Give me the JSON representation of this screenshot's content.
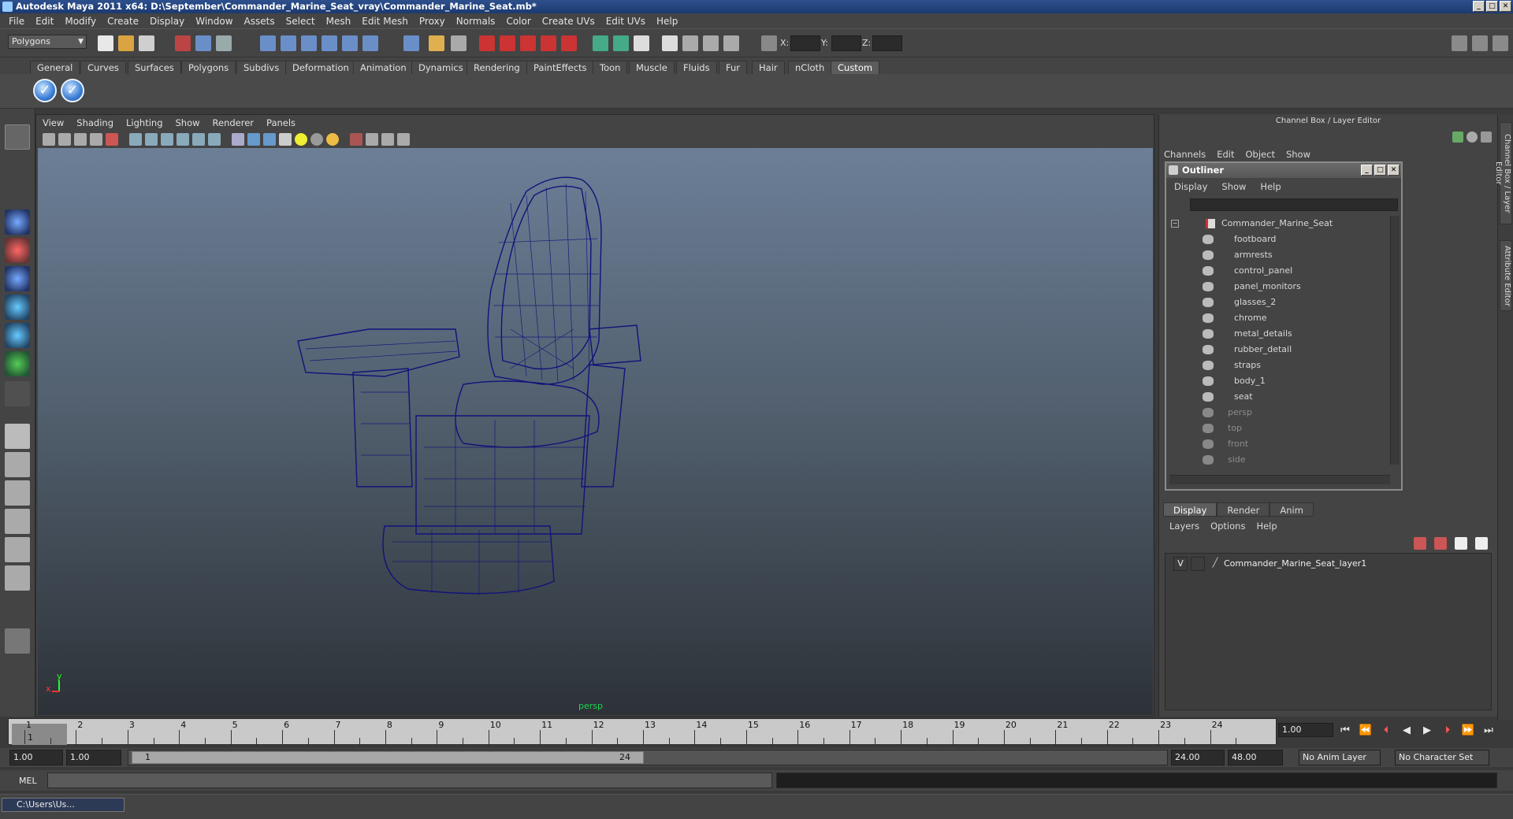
{
  "window": {
    "title": "Autodesk Maya 2011 x64: D:\\September\\Commander_Marine_Seat_vray\\Commander_Marine_Seat.mb*"
  },
  "menubar": [
    "File",
    "Edit",
    "Modify",
    "Create",
    "Display",
    "Window",
    "Assets",
    "Select",
    "Mesh",
    "Edit Mesh",
    "Proxy",
    "Normals",
    "Color",
    "Create UVs",
    "Edit UVs",
    "Help"
  ],
  "status": {
    "mode": "Polygons",
    "x_label": "X:",
    "y_label": "Y:",
    "z_label": "Z:"
  },
  "shelf": {
    "tabs": [
      "General",
      "Curves",
      "Surfaces",
      "Polygons",
      "Subdivs",
      "Deformation",
      "Animation",
      "Dynamics",
      "Rendering",
      "PaintEffects",
      "Toon",
      "Muscle",
      "Fluids",
      "Fur",
      "Hair",
      "nCloth",
      "Custom"
    ],
    "active_tab": "Custom"
  },
  "viewport": {
    "menu": [
      "View",
      "Shading",
      "Lighting",
      "Show",
      "Renderer",
      "Panels"
    ],
    "camera_label": "persp",
    "axis_x": "x",
    "axis_y": "y",
    "wire_color": "#12127a"
  },
  "channel_box": {
    "title": "Channel Box / Layer Editor",
    "menu": [
      "Channels",
      "Edit",
      "Object",
      "Show"
    ]
  },
  "outliner": {
    "title": "Outliner",
    "menu": [
      "Display",
      "Show",
      "Help"
    ],
    "root": "Commander_Marine_Seat",
    "children": [
      "footboard",
      "armrests",
      "control_panel",
      "panel_monitors",
      "glasses_2",
      "chrome",
      "metal_details",
      "rubber_detail",
      "straps",
      "body_1",
      "seat"
    ],
    "cameras": [
      "persp",
      "top",
      "front",
      "side"
    ]
  },
  "layer_editor": {
    "tabs": [
      "Display",
      "Render",
      "Anim"
    ],
    "active_tab": "Display",
    "menu": [
      "Layers",
      "Options",
      "Help"
    ],
    "layer": {
      "visible_flag": "V",
      "name": "Commander_Marine_Seat_layer1"
    }
  },
  "side_tabs": [
    "Channel Box / Layer Editor",
    "Attribute Editor"
  ],
  "timeline": {
    "frames": [
      "1",
      "2",
      "3",
      "4",
      "5",
      "6",
      "7",
      "8",
      "9",
      "10",
      "11",
      "12",
      "13",
      "14",
      "15",
      "16",
      "17",
      "18",
      "19",
      "20",
      "21",
      "22",
      "23",
      "24"
    ],
    "current_frame_label": "1",
    "current_frame_value": "1.00"
  },
  "range": {
    "start": "1.00",
    "playback_start": "1.00",
    "thumb_start": "1",
    "thumb_end": "24",
    "playback_end": "24.00",
    "end": "48.00",
    "anim_layer": "No Anim Layer",
    "character_set": "No Character Set"
  },
  "command_line": {
    "label": "MEL"
  },
  "taskbar": {
    "item": "C:\\Users\\Us..."
  }
}
